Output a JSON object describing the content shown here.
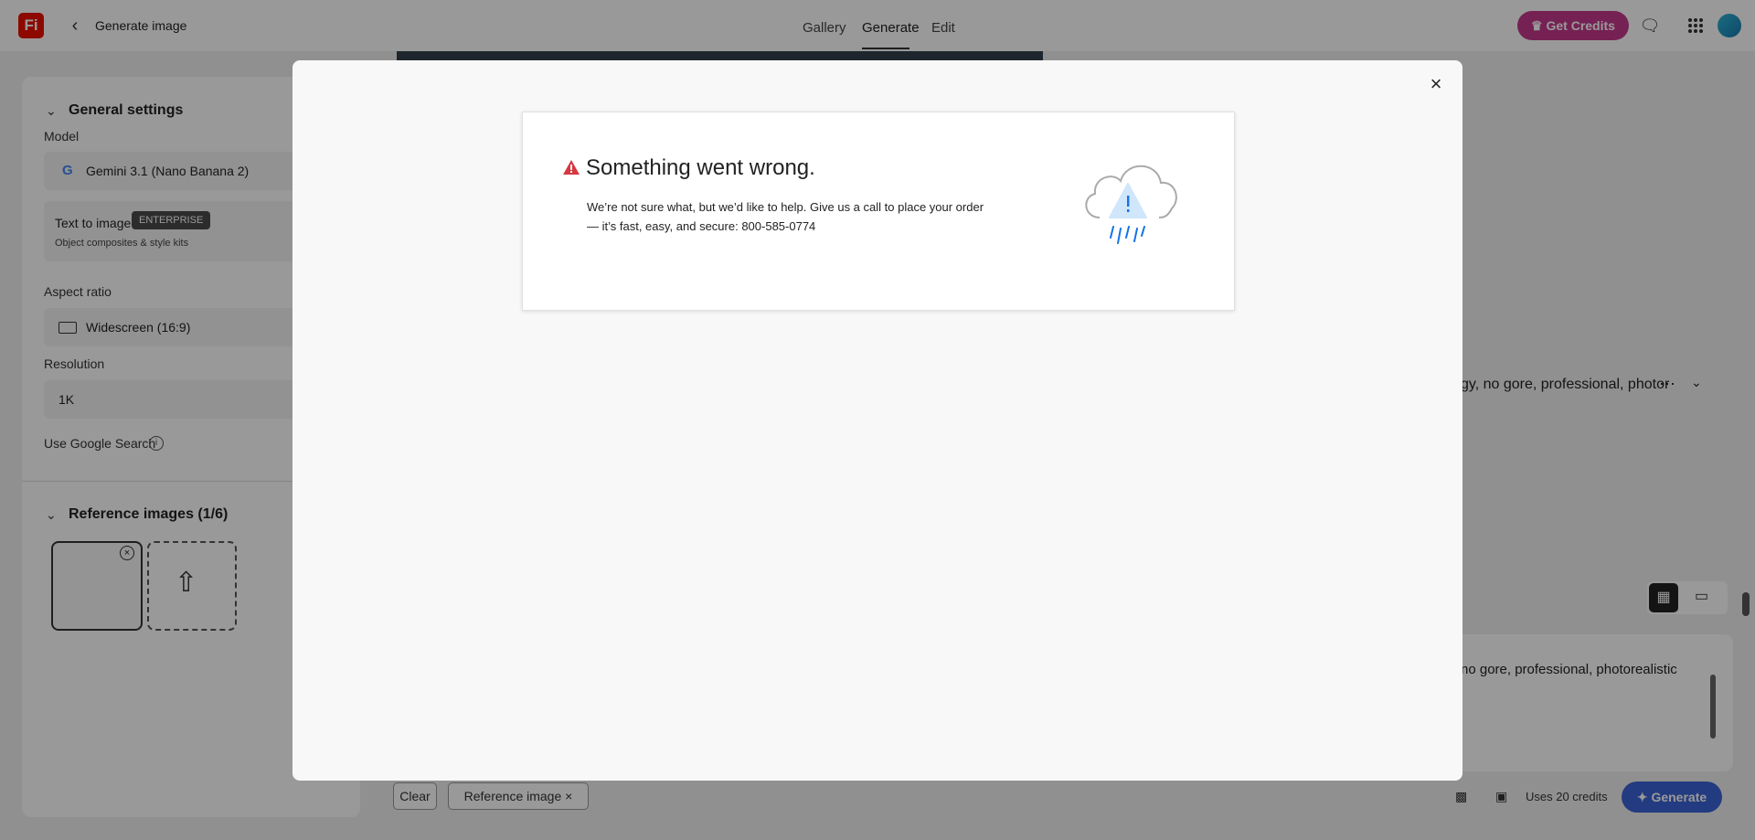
{
  "app": {
    "logo": "Fi",
    "title": "Generate image"
  },
  "nav": {
    "tabs": [
      {
        "label": "Gallery"
      },
      {
        "label": "Generate"
      },
      {
        "label": "Edit"
      }
    ]
  },
  "header": {
    "credits_label": "Get Credits"
  },
  "settings": {
    "title": "General settings",
    "model_label": "Model",
    "model_value": "Gemini 3.1 (Nano Banana 2)",
    "mode_title": "Text to image",
    "mode_badge": "ENTERPRISE",
    "mode_subtitle": "Object composites & style kits",
    "aspect_label": "Aspect ratio",
    "aspect_value": "Widescreen (16:9)",
    "resolution_label": "Resolution",
    "resolution_value": "1K",
    "google_search_label": "Use Google Search"
  },
  "reference": {
    "title": "Reference images (1/6)"
  },
  "prompt": {
    "history_text": "gy, no gore, professional, photor",
    "input_text": "no gore, professional, photorealistic"
  },
  "bottom": {
    "clear_label": "Clear",
    "reference_chip_label": "Reference image",
    "credits_text": "Uses 20 credits",
    "generate_label": "Generate"
  },
  "error": {
    "title": "Something went wrong.",
    "message": "We’re not sure what, but we’d like to help. Give us a call to place your order — it’s fast, easy, and secure: 800-585-0774"
  },
  "colors": {
    "accent": "#3b63d6",
    "credits": "#c4378b",
    "logo": "#eb1000",
    "warning": "#d7373f"
  },
  "icons": [
    "back-arrow-icon",
    "chat-icon",
    "apps-grid-icon",
    "crown-icon",
    "google-icon",
    "aspect-rect-icon",
    "info-icon",
    "upload-image-icon",
    "remove-icon",
    "more-icon",
    "chevron-down-icon",
    "grid-view-icon",
    "single-view-icon",
    "close-icon",
    "warning-icon",
    "cloud-warning-icon"
  ]
}
